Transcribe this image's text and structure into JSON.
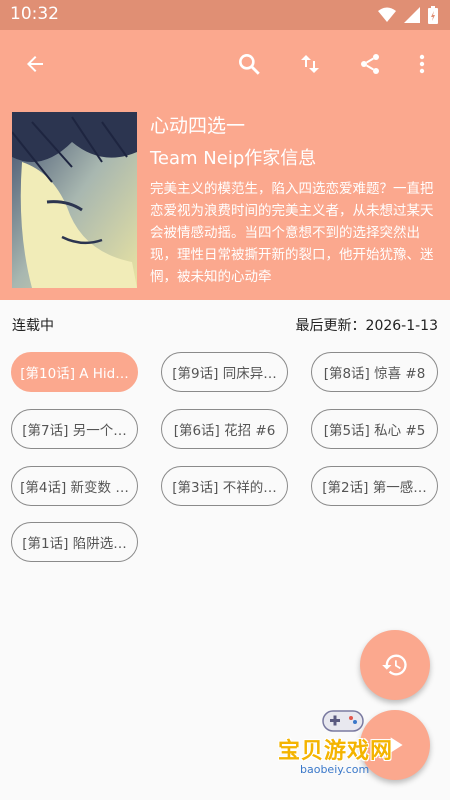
{
  "status_bar": {
    "time": "10:32"
  },
  "toolbar": {
    "back_icon": "arrow-left",
    "search_icon": "search",
    "sort_icon": "swap-vertical",
    "share_icon": "share",
    "more_icon": "more-vertical"
  },
  "comic": {
    "title": "心动四选一",
    "author": "Team Neip作家信息",
    "description": "完美主义的模范生，陷入四选恋爱难题？一直把恋爱视为浪费时间的完美主义者，从未想过某天会被情感动摇。当四个意想不到的选择突然出现，理性日常被撕开新的裂口，他开始犹豫、迷惘，被未知的心动牵"
  },
  "meta": {
    "status": "连载中",
    "last_update_label": "最后更新：",
    "last_update": "2026-1-13"
  },
  "chapters": [
    {
      "label": "[第10话] A Hid…"
    },
    {
      "label": "[第9话] 同床异…"
    },
    {
      "label": "[第8话] 惊喜 #8"
    },
    {
      "label": "[第7话] 另一个…"
    },
    {
      "label": "[第6话] 花招 #6"
    },
    {
      "label": "[第5话] 私心 #5"
    },
    {
      "label": "[第4话] 新变数 …"
    },
    {
      "label": "[第3话] 不祥的…"
    },
    {
      "label": "[第2话] 第一感…"
    },
    {
      "label": "[第1话] 陷阱选…"
    }
  ],
  "fab": {
    "history_icon": "history",
    "secondary_icon": "play"
  },
  "watermark": {
    "text": "宝贝游戏网",
    "url": "baobeiy.com"
  },
  "colors": {
    "accent": "#fba88e",
    "status_bar": "#e08f74"
  }
}
